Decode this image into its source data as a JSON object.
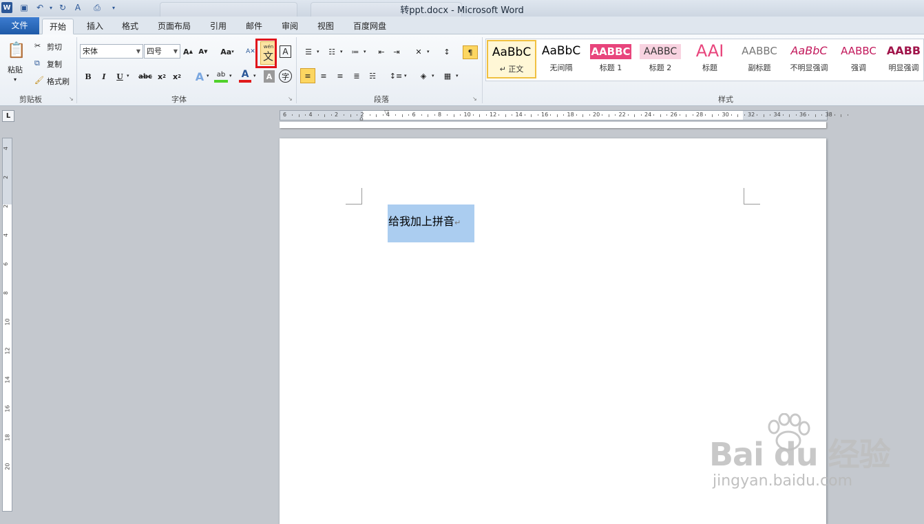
{
  "window": {
    "title": "转ppt.docx - Microsoft Word"
  },
  "tabs": [
    "文件",
    "开始",
    "插入",
    "格式",
    "页面布局",
    "引用",
    "邮件",
    "审阅",
    "视图",
    "百度网盘"
  ],
  "clipboard": {
    "paste": "粘贴",
    "cut": "剪切",
    "copy": "复制",
    "format_painter": "格式刷",
    "group": "剪贴板"
  },
  "font": {
    "name": "宋体",
    "size": "四号",
    "group": "字体",
    "phonetic_label": "wén",
    "phonetic_char": "文",
    "case_label": "Aa",
    "border_char": "A",
    "enclose_char": "字",
    "strike_label": "abc"
  },
  "paragraph": {
    "group": "段落"
  },
  "styles": {
    "group": "样式",
    "items": [
      {
        "sample": "AaBbC",
        "name": "↵ 正文",
        "color": "#000000"
      },
      {
        "sample": "AaBbC",
        "name": "无间隔",
        "color": "#000000"
      },
      {
        "sample": "AABBC",
        "name": "标题 1",
        "color": "#ffffff"
      },
      {
        "sample": "AABBC",
        "name": "标题 2",
        "color": "#333333"
      },
      {
        "sample": "AAI",
        "name": "标题",
        "color": "#e8457c"
      },
      {
        "sample": "AABBC",
        "name": "副标题",
        "color": "#777777"
      },
      {
        "sample": "AaBbC",
        "name": "不明显强调",
        "color": "#c2185b"
      },
      {
        "sample": "AABBC",
        "name": "强调",
        "color": "#c2185b"
      },
      {
        "sample": "AABB",
        "name": "明显强调",
        "color": "#a0144a"
      }
    ]
  },
  "ruler": {
    "h_labels": [
      "6",
      "4",
      "2",
      "2",
      "4",
      "6",
      "8",
      "10",
      "12",
      "14",
      "16",
      "18",
      "20",
      "22",
      "24",
      "26",
      "28",
      "30",
      "32",
      "34",
      "36",
      "38"
    ],
    "v_labels": [
      "4",
      "2",
      "2",
      "4",
      "6",
      "8",
      "10",
      "12",
      "14",
      "16",
      "18",
      "20"
    ]
  },
  "document": {
    "text": "给我加上拼音",
    "para_mark": "↵"
  },
  "watermark": {
    "brand": "Bai du 经验",
    "url": "jingyan.baidu.com"
  },
  "colors": {
    "accent": "#2b5797",
    "highlight_border": "#e0131b",
    "selection": "#abcdf0"
  }
}
